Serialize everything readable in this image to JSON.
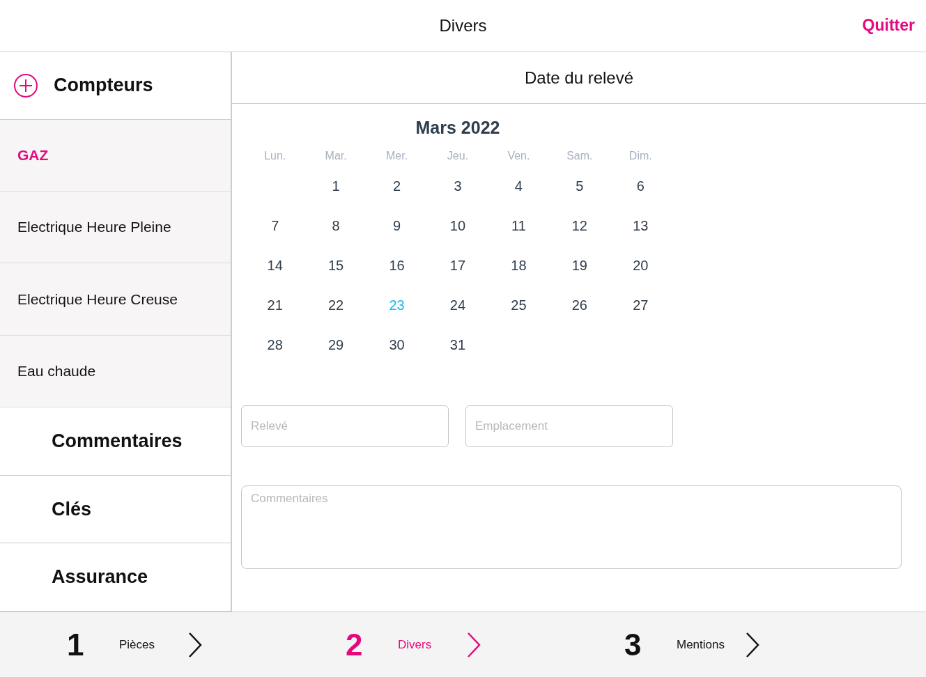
{
  "header": {
    "title": "Divers",
    "quit_label": "Quitter"
  },
  "sidebar": {
    "group_title": "Compteurs",
    "items": [
      {
        "label": "GAZ",
        "selected": true
      },
      {
        "label": "Electrique Heure Pleine",
        "selected": false
      },
      {
        "label": "Electrique Heure Creuse",
        "selected": false
      },
      {
        "label": "Eau chaude",
        "selected": false
      }
    ],
    "sections": [
      {
        "label": "Commentaires"
      },
      {
        "label": "Clés"
      },
      {
        "label": "Assurance"
      }
    ]
  },
  "panel_title": "Date du relevé",
  "calendar": {
    "month": "Mars 2022",
    "weekdays": [
      "Lun.",
      "Mar.",
      "Mer.",
      "Jeu.",
      "Ven.",
      "Sam.",
      "Dim."
    ],
    "weeks": [
      {
        "right_aligned": true,
        "days": [
          {
            "label": "1",
            "selected": false
          },
          {
            "label": "2",
            "selected": false
          },
          {
            "label": "3",
            "selected": false
          },
          {
            "label": "4",
            "selected": false
          },
          {
            "label": "5",
            "selected": false
          },
          {
            "label": "6",
            "selected": false
          }
        ]
      },
      {
        "days": [
          {
            "label": "7",
            "selected": false
          },
          {
            "label": "8",
            "selected": false
          },
          {
            "label": "9",
            "selected": false
          },
          {
            "label": "10",
            "selected": false
          },
          {
            "label": "11",
            "selected": false
          },
          {
            "label": "12",
            "selected": false
          },
          {
            "label": "13",
            "selected": false
          }
        ]
      },
      {
        "days": [
          {
            "label": "14",
            "selected": false
          },
          {
            "label": "15",
            "selected": false
          },
          {
            "label": "16",
            "selected": false
          },
          {
            "label": "17",
            "selected": false
          },
          {
            "label": "18",
            "selected": false
          },
          {
            "label": "19",
            "selected": false
          },
          {
            "label": "20",
            "selected": false
          }
        ]
      },
      {
        "days": [
          {
            "label": "21",
            "selected": false
          },
          {
            "label": "22",
            "selected": false
          },
          {
            "label": "23",
            "selected": true
          },
          {
            "label": "24",
            "selected": false
          },
          {
            "label": "25",
            "selected": false
          },
          {
            "label": "26",
            "selected": false
          },
          {
            "label": "27",
            "selected": false
          }
        ]
      },
      {
        "right_aligned": false,
        "days": [
          {
            "label": "28",
            "selected": false
          },
          {
            "label": "29",
            "selected": false
          },
          {
            "label": "30",
            "selected": false
          },
          {
            "label": "31",
            "selected": false
          }
        ]
      }
    ]
  },
  "fields": [
    {
      "placeholder": "Relevé"
    },
    {
      "placeholder": "Emplacement"
    }
  ],
  "comments": {
    "placeholder": "Commentaires"
  },
  "steps": [
    {
      "number": "1",
      "label": "Pièces",
      "selected": false
    },
    {
      "number": "2",
      "label": "Divers",
      "selected": true
    },
    {
      "number": "3",
      "label": "Mentions",
      "selected": false
    }
  ]
}
